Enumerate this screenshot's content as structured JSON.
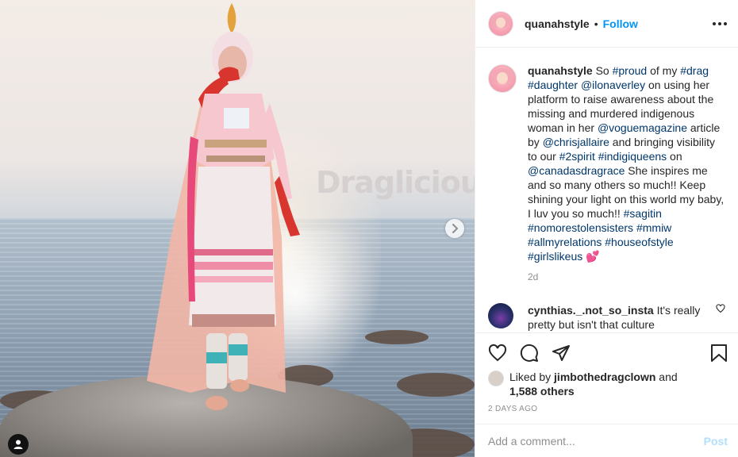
{
  "post": {
    "username": "quanahstyle",
    "follow_label": "Follow",
    "separator": "•",
    "watermark": "Draglicious",
    "caption_parts": [
      {
        "t": "text",
        "v": "So "
      },
      {
        "t": "link",
        "v": "#proud"
      },
      {
        "t": "text",
        "v": " of my "
      },
      {
        "t": "link",
        "v": "#drag"
      },
      {
        "t": "text",
        "v": " "
      },
      {
        "t": "link",
        "v": "#daughter"
      },
      {
        "t": "text",
        "v": " "
      },
      {
        "t": "link",
        "v": "@ilonaverley"
      },
      {
        "t": "text",
        "v": " on using her platform to raise awareness about the missing and murdered indigenous woman in her "
      },
      {
        "t": "link",
        "v": "@voguemagazine"
      },
      {
        "t": "text",
        "v": " article by "
      },
      {
        "t": "link",
        "v": "@chrisjallaire"
      },
      {
        "t": "text",
        "v": " and bringing visibility to our "
      },
      {
        "t": "link",
        "v": "#2spirit"
      },
      {
        "t": "text",
        "v": " "
      },
      {
        "t": "link",
        "v": "#indigiqueens"
      },
      {
        "t": "text",
        "v": " on "
      },
      {
        "t": "link",
        "v": "@canadasdragrace"
      },
      {
        "t": "text",
        "v": " She inspires me and so many others so much!! Keep shining your light on this world my baby, I luv you so much!! "
      },
      {
        "t": "link",
        "v": "#sagitin"
      },
      {
        "t": "text",
        "v": " "
      },
      {
        "t": "link",
        "v": "#nomorestolensisters"
      },
      {
        "t": "text",
        "v": " "
      },
      {
        "t": "link",
        "v": "#mmiw"
      },
      {
        "t": "text",
        "v": " "
      },
      {
        "t": "link",
        "v": "#allmyrelations"
      },
      {
        "t": "text",
        "v": " "
      },
      {
        "t": "link",
        "v": "#houseofstyle"
      },
      {
        "t": "text",
        "v": " "
      },
      {
        "t": "link",
        "v": "#girlslikeus"
      },
      {
        "t": "text",
        "v": " 💕"
      }
    ],
    "caption_time": "2d",
    "comment": {
      "username": "cynthias._.not_so_insta",
      "text": "It's really pretty but isn't that culture"
    },
    "liked_by_prefix": "Liked by",
    "liked_by_user": "jimbothedragclown",
    "liked_by_and": "and",
    "others_count": "1,588 others",
    "date": "2 DAYS AGO",
    "add_comment_placeholder": "Add a comment...",
    "post_button": "Post"
  },
  "icons": {
    "more": "more-horizontal-icon",
    "like": "heart-icon",
    "comment": "comment-bubble-icon",
    "share": "paper-plane-icon",
    "save": "bookmark-icon",
    "next": "chevron-right-icon",
    "tagged": "user-tag-icon"
  },
  "colors": {
    "link": "#00376b",
    "follow": "#0095f6",
    "post_disabled": "#b2dffc",
    "meta": "#8e8e8e"
  }
}
